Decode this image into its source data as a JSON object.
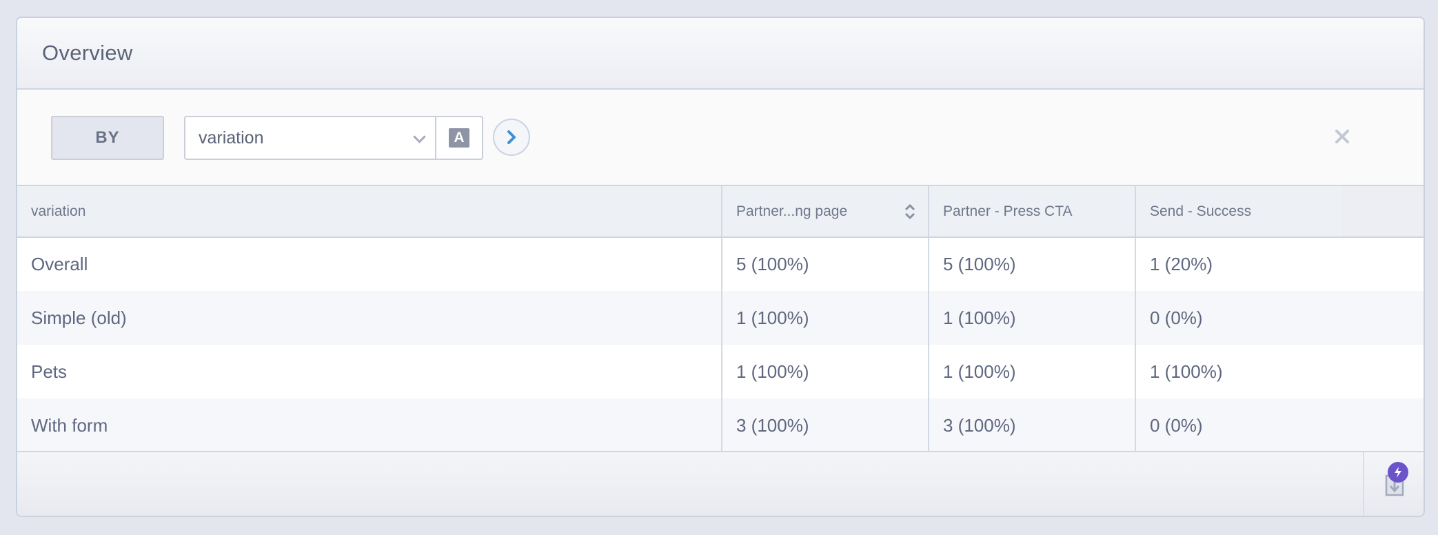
{
  "panel": {
    "title": "Overview"
  },
  "toolbar": {
    "by_label": "BY",
    "group_by": {
      "value": "variation"
    },
    "type_toggle_label": "A",
    "icons": {
      "dropdown": "chevron-down-icon",
      "go": "chevron-right-icon",
      "close": "close-icon"
    }
  },
  "table": {
    "columns": [
      {
        "label": "variation"
      },
      {
        "label": "Partner...ng page",
        "sortable": true
      },
      {
        "label": "Partner - Press CTA"
      },
      {
        "label": "Send - Success"
      }
    ],
    "rows": [
      {
        "variation": "Overall",
        "c1": "5 (100%)",
        "c2": "5 (100%)",
        "c3": "1 (20%)"
      },
      {
        "variation": "Simple (old)",
        "c1": "1 (100%)",
        "c2": "1 (100%)",
        "c3": "0 (0%)"
      },
      {
        "variation": "Pets",
        "c1": "1 (100%)",
        "c2": "1 (100%)",
        "c3": "1 (100%)"
      },
      {
        "variation": "With form",
        "c1": "3 (100%)",
        "c2": "3 (100%)",
        "c3": "0 (0%)"
      }
    ]
  },
  "footer": {
    "icons": {
      "export": "export-icon",
      "badge": "lightning-icon"
    },
    "badge_color": "#6b53c9"
  },
  "colors": {
    "accent": "#3d8fd6",
    "text": "#5f6780",
    "border": "#cfd6e1"
  }
}
